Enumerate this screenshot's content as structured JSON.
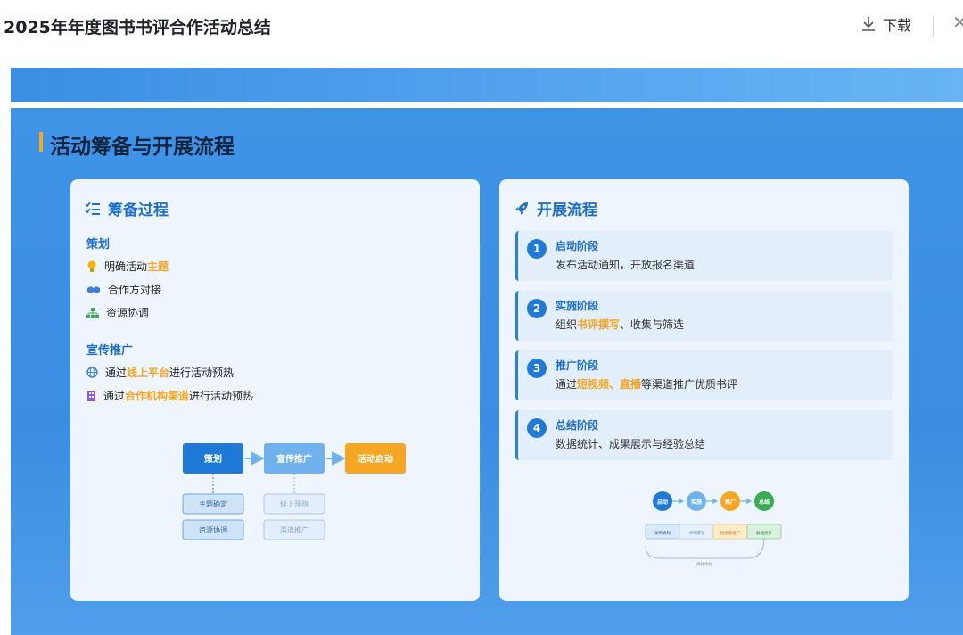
{
  "header": {
    "title": "2025年年度图书书评合作活动总结",
    "download_label": "下载"
  },
  "slide": {
    "title": "活动筹备与开展流程",
    "prep": {
      "heading": "筹备过程",
      "plan_heading": "策划",
      "plan_items": [
        {
          "icon": "lightbulb-icon",
          "text_before": "明确活动",
          "highlight": "主题",
          "text_after": ""
        },
        {
          "icon": "handshake-icon",
          "text_before": "合作方对接",
          "highlight": "",
          "text_after": ""
        },
        {
          "icon": "sitemap-icon",
          "text_before": "资源协调",
          "highlight": "",
          "text_after": ""
        }
      ],
      "promo_heading": "宣传推广",
      "promo_items": [
        {
          "icon": "globe-icon",
          "text_before": "通过",
          "highlight": "线上平台",
          "text_after": "进行活动预热"
        },
        {
          "icon": "building-icon",
          "text_before": "通过",
          "highlight": "合作机构渠道",
          "text_after": "进行活动预热"
        }
      ],
      "flow": {
        "nodes": [
          "策划",
          "宣传推广",
          "活动启动"
        ],
        "sub_left": [
          "主题确定",
          "资源协调"
        ],
        "sub_mid": [
          "线上预热",
          "渠道推广"
        ],
        "colors": {
          "primary": "#1e7ad6",
          "light": "#6fb2ee",
          "accent": "#f5a623"
        }
      }
    },
    "process": {
      "heading": "开展流程",
      "steps": [
        {
          "num": "1",
          "title": "启动阶段",
          "desc_before": "发布活动通知，开放报名渠道",
          "highlight": "",
          "desc_after": ""
        },
        {
          "num": "2",
          "title": "实施阶段",
          "desc_before": "组织",
          "highlight": "书评撰写",
          "desc_after": "、收集与筛选"
        },
        {
          "num": "3",
          "title": "推广阶段",
          "desc_before": "通过",
          "highlight": "短视频、直播",
          "desc_after": "等渠道推广优质书评"
        },
        {
          "num": "4",
          "title": "总结阶段",
          "desc_before": "数据统计、成果展示与经验总结",
          "highlight": "",
          "desc_after": ""
        }
      ],
      "mini_flow": {
        "nodes": [
          "启动",
          "实施",
          "推广",
          "总结"
        ],
        "node_colors": [
          "#1e7ad6",
          "#6fb2ee",
          "#f5a623",
          "#3aaa55"
        ],
        "subs": [
          "发布通知",
          "书评撰写",
          "短视频推广",
          "数据统计"
        ],
        "loop_label": "持续优化"
      }
    }
  }
}
